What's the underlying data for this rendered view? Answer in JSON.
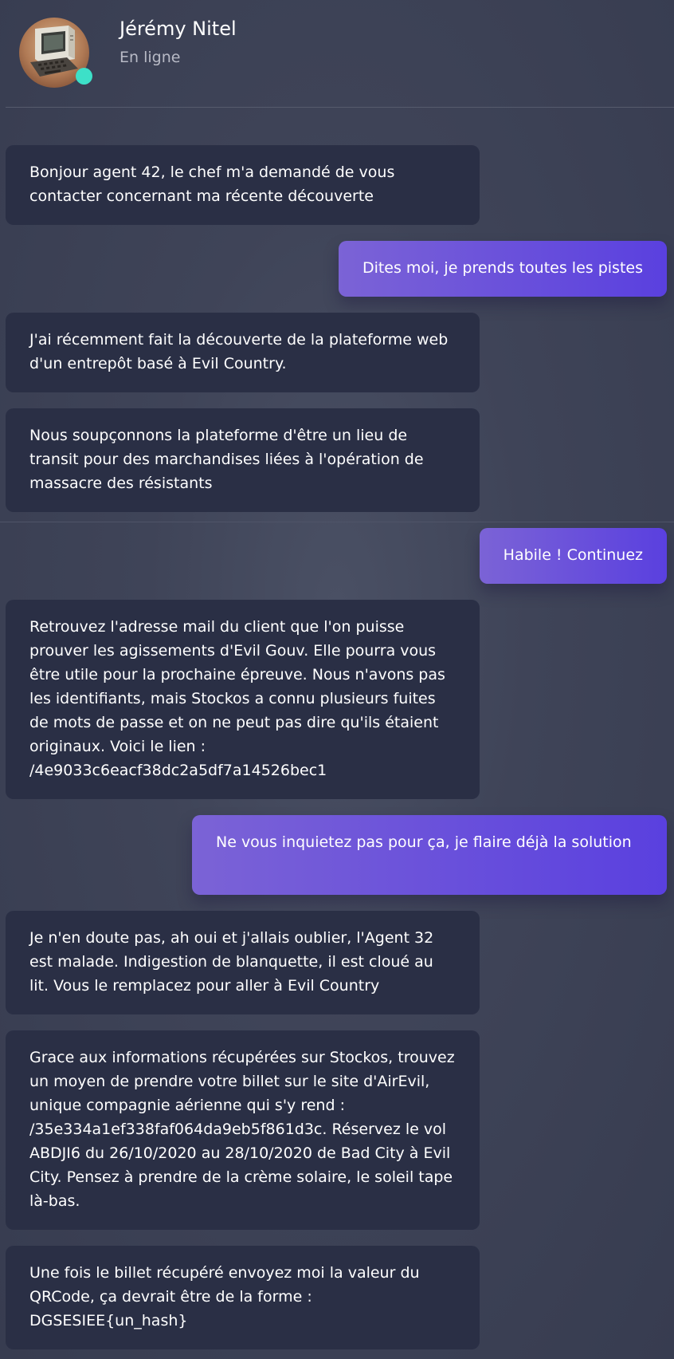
{
  "header": {
    "contact_name": "Jérémy Nitel",
    "status": "En ligne",
    "status_color": "#3de0c8",
    "avatar_icon": "vintage-computer-avatar"
  },
  "messages": [
    {
      "direction": "in",
      "text": "Bonjour agent 42, le chef m'a demandé de vous contacter concernant ma récente découverte"
    },
    {
      "direction": "out",
      "text": "Dites moi, je prends toutes les pistes"
    },
    {
      "direction": "in",
      "text": "J'ai récemment fait la découverte de la plateforme web d'un entrepôt basé à Evil Country."
    },
    {
      "direction": "in",
      "text": "Nous soupçonnons la plateforme d'être un lieu de transit pour des marchandises liées à l'opération de massacre des résistants"
    },
    {
      "direction": "out",
      "text": "Habile ! Continuez"
    },
    {
      "direction": "in",
      "text": "Retrouvez l'adresse mail du client que l'on puisse prouver les agissements d'Evil Gouv. Elle pourra vous être utile pour la prochaine épreuve. Nous n'avons pas les identifiants, mais Stockos a connu plusieurs fuites de mots de passe et on ne peut pas dire qu'ils étaient originaux. Voici le lien : /4e9033c6eacf38dc2a5df7a14526bec1"
    },
    {
      "direction": "out",
      "text": "Ne vous inquietez pas pour ça, je flaire déjà la solution"
    },
    {
      "direction": "in",
      "text": "Je n'en doute pas, ah oui et j'allais oublier, l'Agent 32 est malade. Indigestion de blanquette, il est cloué au lit. Vous le remplacez pour aller à Evil Country"
    },
    {
      "direction": "in",
      "text": "Grace aux informations récupérées sur Stockos, trouvez un moyen de prendre votre billet sur le site d'AirEvil, unique compagnie aérienne qui s'y rend : /35e334a1ef338faf064da9eb5f861d3c. Réservez le vol ABDJI6 du 26/10/2020 au 28/10/2020 de Bad City à Evil City. Pensez à prendre de la crème solaire, le soleil tape là-bas."
    },
    {
      "direction": "in",
      "text": "Une fois le billet récupéré envoyez moi la valeur du QRCode, ça devrait être de la forme : DGSESIEE{un_hash}"
    }
  ],
  "colors": {
    "incoming_bubble": "#2a2f45",
    "outgoing_gradient_start": "#7b63d6",
    "outgoing_gradient_end": "#5a40df"
  }
}
